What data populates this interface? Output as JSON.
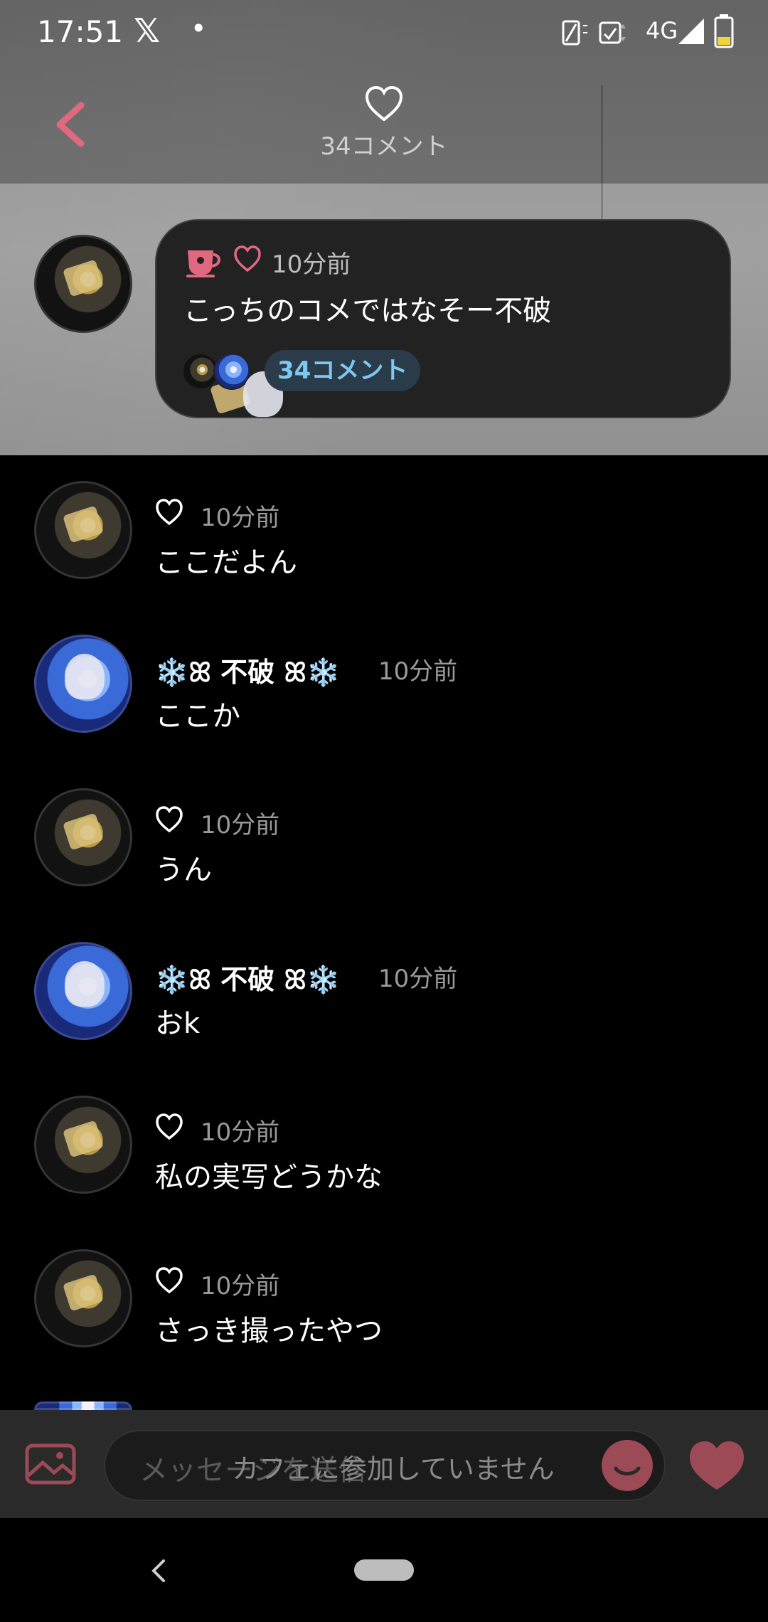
{
  "status_bar": {
    "time": "17:51",
    "x_app_glyph": "𝕏",
    "dot": "•",
    "network": "4G"
  },
  "header": {
    "comment_count_label": "34コメント"
  },
  "pinned": {
    "time": "10分前",
    "text": "こっちのコメではなそー不破",
    "reply_chip": "34コメント"
  },
  "comments": [
    {
      "name": "",
      "time": "10分前",
      "text": "ここだよん",
      "avatar": "a"
    },
    {
      "name": "❄️ꕤ 不破 ꕤ❄️",
      "time": "10分前",
      "text": "ここか",
      "avatar": "b"
    },
    {
      "name": "",
      "time": "10分前",
      "text": "うん",
      "avatar": "a"
    },
    {
      "name": "❄️ꕤ 不破 ꕤ❄️",
      "time": "10分前",
      "text": "おk",
      "avatar": "b"
    },
    {
      "name": "",
      "time": "10分前",
      "text": "私の実写どうかな",
      "avatar": "a"
    },
    {
      "name": "",
      "time": "10分前",
      "text": "さっき撮ったやつ",
      "avatar": "a"
    }
  ],
  "composer": {
    "placeholder": "メッセージを送信",
    "not_joined_notice": "カフェに参加していません"
  },
  "colors": {
    "accent_pink": "#e0697f",
    "chip_blue": "#7ec8f0"
  }
}
